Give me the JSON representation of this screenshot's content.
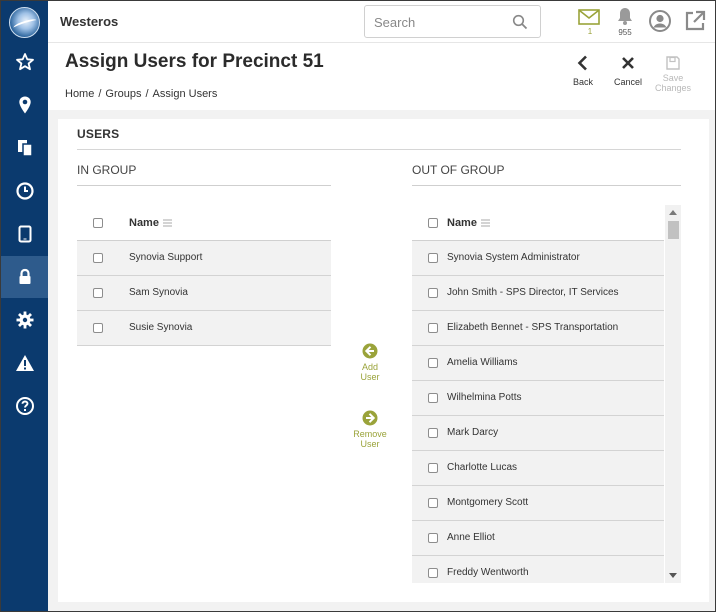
{
  "app": {
    "title": "Westeros"
  },
  "search": {
    "placeholder": "Search"
  },
  "header": {
    "messages_count": "1",
    "notifications_count": "955"
  },
  "page": {
    "title": "Assign Users for Precinct 51",
    "breadcrumb": [
      "Home",
      "Groups",
      "Assign Users"
    ]
  },
  "toolbar": {
    "back_label": "Back",
    "cancel_label": "Cancel",
    "save_label_line1": "Save",
    "save_label_line2": "Changes"
  },
  "section": {
    "title": "USERS"
  },
  "in_group": {
    "title": "IN GROUP",
    "column_header": "Name",
    "rows": [
      "Synovia Support",
      "Sam Synovia",
      "Susie Synovia"
    ]
  },
  "out_group": {
    "title": "OUT OF GROUP",
    "column_header": "Name",
    "rows": [
      "Synovia System Administrator",
      "John Smith - SPS Director, IT Services",
      "Elizabeth Bennet - SPS Transportation",
      "Amelia Williams",
      "Wilhelmina Potts",
      "Mark Darcy",
      "Charlotte Lucas",
      "Montgomery Scott",
      "Anne Elliot",
      "Freddy Wentworth"
    ]
  },
  "actions": {
    "add_line1": "Add",
    "add_line2": "User",
    "remove_line1": "Remove",
    "remove_line2": "User"
  },
  "colors": {
    "sidebar": "#0b3a6e",
    "sidebar_active": "#2e5b8c",
    "accent": "#9aa33a",
    "row_bg": "#f2f2f2"
  },
  "sidebar_icons": [
    "star-icon",
    "map-pin-icon",
    "documents-icon",
    "clock-icon",
    "tablet-icon",
    "lock-icon",
    "gear-icon",
    "warning-icon",
    "help-icon"
  ]
}
